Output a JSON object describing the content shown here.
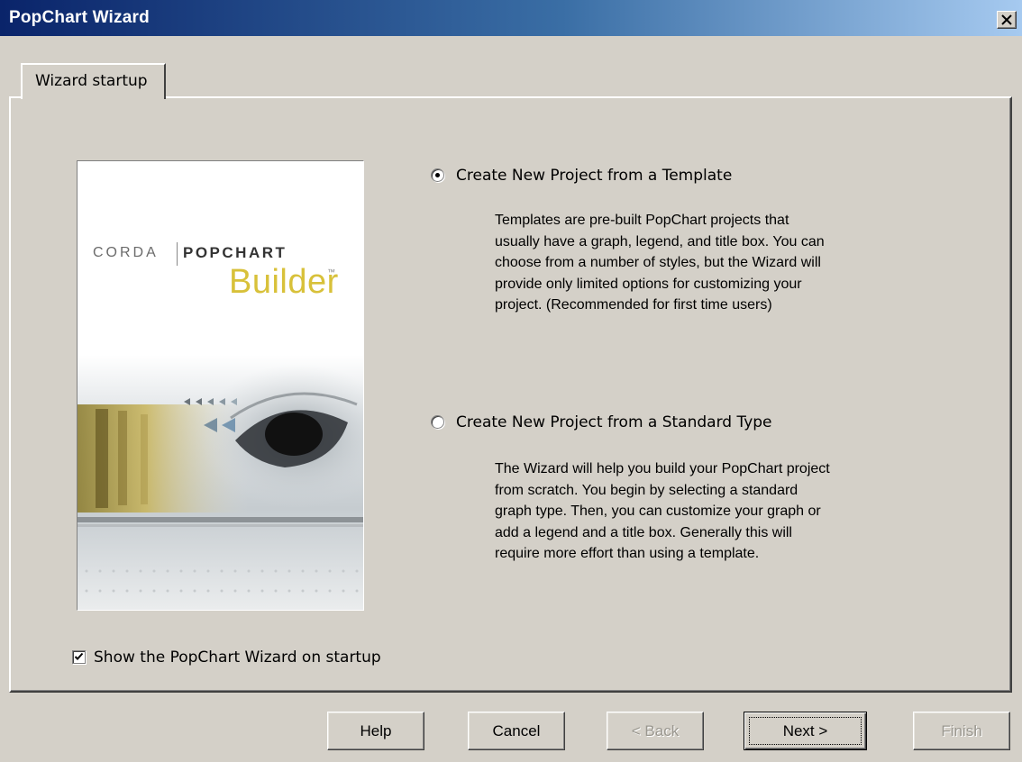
{
  "window": {
    "title": "PopChart Wizard"
  },
  "tabs": [
    {
      "label": "Wizard startup",
      "selected": true
    }
  ],
  "splash": {
    "brand": "CORDA",
    "product_top": "POPCHART",
    "product_bottom": "Builder",
    "trademark": "™"
  },
  "options": [
    {
      "label": "Create New Project from a Template",
      "selected": true,
      "description": [
        "Templates are pre-built PopChart projects that",
        "usually have a graph, legend, and title box.  You can",
        "choose from a number of styles, but the Wizard will",
        "provide only limited options for customizing your",
        "project. (Recommended for first time users)"
      ]
    },
    {
      "label": "Create New Project from a Standard Type",
      "selected": false,
      "description": [
        "The Wizard will help you build your PopChart project",
        "from scratch.  You begin by selecting a standard",
        "graph type.  Then, you can customize your graph or",
        "add a legend and a title box.  Generally this will",
        "require more effort than using a template."
      ]
    }
  ],
  "startup_checkbox": {
    "label": "Show the PopChart Wizard on startup",
    "checked": true
  },
  "buttons": {
    "help": "Help",
    "cancel": "Cancel",
    "back": "< Back",
    "next": "Next >",
    "finish": "Finish"
  },
  "colors": {
    "title_gradient_start": "#0a246a",
    "title_gradient_end": "#a6caf0",
    "dialog_face": "#d4d0c8",
    "builder_logo": "#d8c13a"
  }
}
